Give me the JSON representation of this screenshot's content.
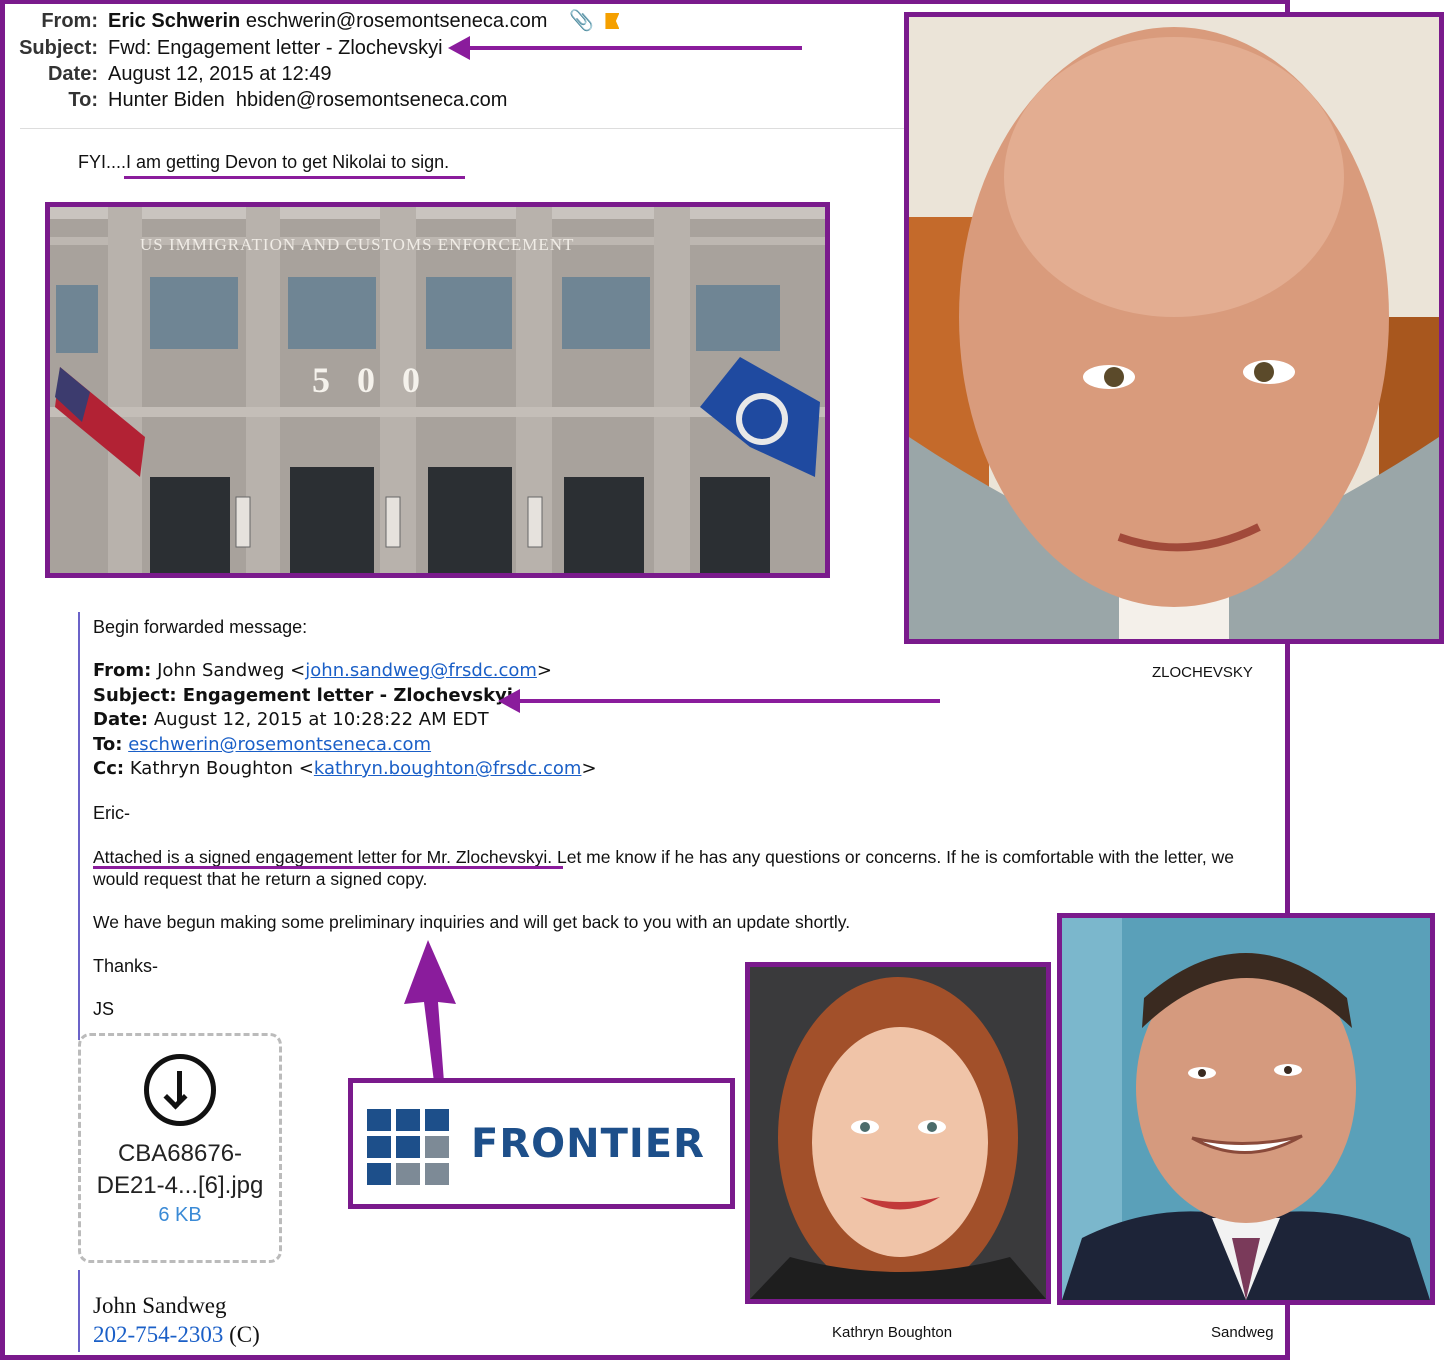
{
  "email": {
    "from_label": "From:",
    "from_name": "Eric Schwerin",
    "from_email": "eschwerin@rosemontseneca.com",
    "subject_label": "Subject:",
    "subject": "Fwd: Engagement letter - Zlochevskyi",
    "date_label": "Date:",
    "date": "August 12, 2015 at 12:49",
    "to_label": "To:",
    "to_name": "Hunter Biden",
    "to_email": "hbiden@rosemontseneca.com",
    "body": "FYI....I am getting Devon to get Nikolai to sign."
  },
  "forwarded": {
    "intro": "Begin forwarded message:",
    "from_label": "From:",
    "from_value": "John Sandweg <",
    "from_email": "john.sandweg@frsdc.com",
    "from_end": ">",
    "subject_label": "Subject:",
    "subject": "Engagement letter - Zlochevskyi",
    "date_label": "Date:",
    "date": "August 12, 2015 at 10:28:22 AM EDT",
    "to_label": "To:",
    "to_email": "eschwerin@rosemontseneca.com",
    "cc_label": "Cc:",
    "cc_value": "Kathryn Boughton <",
    "cc_email": "kathryn.boughton@frsdc.com",
    "cc_end": ">",
    "greeting": "Eric-",
    "para1_a": "Attached is a signed engagement letter for Mr. Zlochevskyi",
    "para1_b": ".  Let me know if he has any questions or concerns.  If he is comfortable with the letter, we",
    "para1_c": "would request that he return a signed copy.",
    "para2": "We have begun making some preliminary inquiries and will get back to you with an update shortly.",
    "thanks": "Thanks-",
    "sign": "JS"
  },
  "attachment": {
    "name_line1": "CBA68676-",
    "name_line2": "DE21-4...[6].jpg",
    "size": "6 KB"
  },
  "signature": {
    "name": "John Sandweg",
    "phone": "202-754-2303",
    "phone_suffix": " (C)"
  },
  "building": {
    "sign": "US IMMIGRATION AND CUSTOMS ENFORCEMENT",
    "number": "5   0   0"
  },
  "logo": {
    "text": "FRONTIER"
  },
  "captions": {
    "zlochevsky": "ZLOCHEVSKY",
    "boughton": "Kathryn Boughton",
    "sandweg": "Sandweg"
  },
  "colors": {
    "accent": "#7a1a8c",
    "link": "#1a5fc7",
    "logo_blue": "#1d4f8a",
    "flag": "#f5a000"
  }
}
